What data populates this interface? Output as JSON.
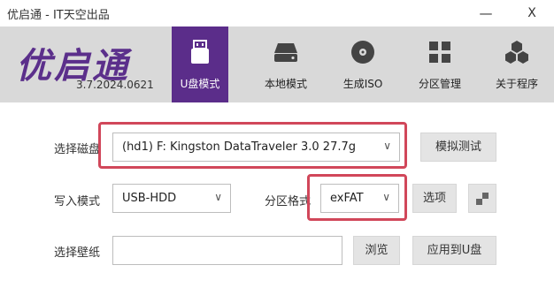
{
  "window": {
    "title": "优启通 - IT天空出品",
    "minimize_label": "—",
    "close_label": "X"
  },
  "app": {
    "logo_text": "优启通",
    "version": "3.7.2024.0621"
  },
  "tabs": [
    {
      "label": "U盘模式",
      "icon": "usb-drive-icon",
      "active": true
    },
    {
      "label": "本地模式",
      "icon": "hard-disk-icon",
      "active": false
    },
    {
      "label": "生成ISO",
      "icon": "disc-icon",
      "active": false
    },
    {
      "label": "分区管理",
      "icon": "partition-grid-icon",
      "active": false
    },
    {
      "label": "关于程序",
      "icon": "hexagons-icon",
      "active": false
    }
  ],
  "form": {
    "disk_label": "选择磁盘",
    "disk_value": "(hd1) F: Kingston DataTraveler 3.0 27.7g",
    "simulate_button": "模拟测试",
    "write_mode_label": "写入模式",
    "write_mode_value": "USB-HDD",
    "partition_format_label": "分区格式",
    "partition_format_value": "exFAT",
    "options_button": "选项",
    "wallpaper_label": "选择壁纸",
    "wallpaper_value": "",
    "browse_button": "浏览",
    "apply_button": "应用到U盘"
  },
  "colors": {
    "accent": "#5b2d8a",
    "header_bg": "#d9d9d9",
    "highlight": "#d1475a"
  }
}
